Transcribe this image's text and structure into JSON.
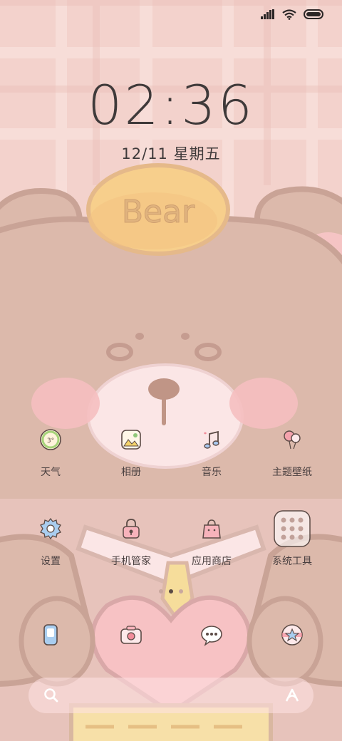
{
  "status": {
    "signal_icon": "signal-bars-icon",
    "wifi_icon": "wifi-icon",
    "battery_icon": "battery-icon"
  },
  "lock": {
    "time": "02:36",
    "date": "12/11 星期五"
  },
  "wallpaper": {
    "badge_text": "Bear"
  },
  "apps_row1": [
    {
      "label": "天气",
      "icon": "weather-icon",
      "temp": "3°"
    },
    {
      "label": "相册",
      "icon": "gallery-icon"
    },
    {
      "label": "音乐",
      "icon": "music-icon"
    },
    {
      "label": "主题壁纸",
      "icon": "themes-icon"
    }
  ],
  "apps_row2": [
    {
      "label": "设置",
      "icon": "settings-icon"
    },
    {
      "label": "手机管家",
      "icon": "security-icon"
    },
    {
      "label": "应用商店",
      "icon": "app-store-icon"
    },
    {
      "label": "系统工具",
      "icon": "system-tools-folder-icon"
    }
  ],
  "dock": [
    {
      "icon": "phone-icon"
    },
    {
      "icon": "camera-icon"
    },
    {
      "icon": "messages-icon"
    },
    {
      "icon": "browser-icon"
    }
  ],
  "pages": {
    "count": 2,
    "active": 1
  },
  "search": {
    "search_icon": "search-icon",
    "assistant_icon": "assistant-icon"
  },
  "colors": {
    "background": "#f3d2cc",
    "bear_body": "#dcb9ab",
    "bear_outline": "#c9a396",
    "text": "#3f3a3a",
    "accent_yellow": "#f7cf8c"
  }
}
